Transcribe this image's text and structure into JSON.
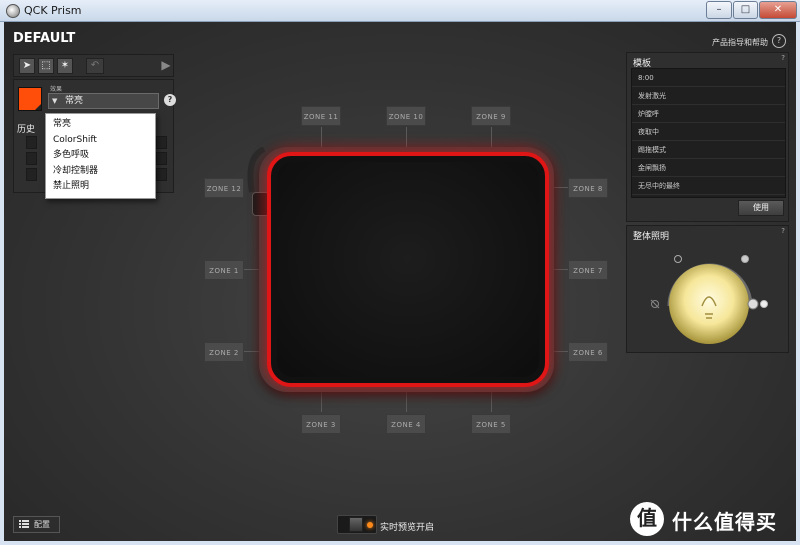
{
  "window": {
    "title": "QCK Prism",
    "min": "–",
    "max": "□",
    "close": "✕"
  },
  "header": {
    "title": "DEFAULT",
    "help_link": "产品指导和帮助",
    "help_icon": "?"
  },
  "toolbar": {
    "tools": [
      "select-arrow-icon",
      "marquee-select-icon",
      "magic-wand-icon",
      "undo-icon",
      "play-icon"
    ]
  },
  "effect": {
    "color": "#ff4d0a",
    "mode_label": "效果",
    "selected": "常亮",
    "help": "?",
    "history_label": "历史",
    "options": [
      "常亮",
      "ColorShift",
      "多色呼吸",
      "冷却控制器",
      "禁止照明"
    ]
  },
  "zones": {
    "z1": "ZONE 1",
    "z2": "ZONE 2",
    "z3": "ZONE 3",
    "z4": "ZONE 4",
    "z5": "ZONE 5",
    "z6": "ZONE 6",
    "z7": "ZONE 7",
    "z8": "ZONE 8",
    "z9": "ZONE 9",
    "z10": "ZONE 10",
    "z11": "ZONE 11",
    "z12": "ZONE 12"
  },
  "mat": {
    "glow_color": "#e01515"
  },
  "templates": {
    "title": "模板",
    "help": "?",
    "items": [
      "8:00",
      "发射激光",
      "炉膛呼",
      "夜取中",
      "踢拖模式",
      "金闸飘扬",
      "无尽中的最终"
    ],
    "use_button": "使用"
  },
  "overall": {
    "title": "整体照明",
    "help": "?"
  },
  "bottom": {
    "config_label": "配置",
    "preview_label": "实时预览开启",
    "preview_led": "#ff8a1a"
  },
  "watermark": {
    "logo": "值",
    "text": "什么值得买"
  }
}
